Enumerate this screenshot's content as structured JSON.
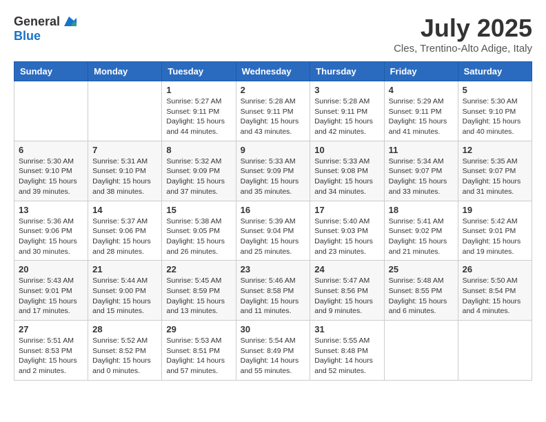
{
  "header": {
    "logo": {
      "general": "General",
      "blue": "Blue"
    },
    "title": "July 2025",
    "location": "Cles, Trentino-Alto Adige, Italy"
  },
  "calendar": {
    "weekdays": [
      "Sunday",
      "Monday",
      "Tuesday",
      "Wednesday",
      "Thursday",
      "Friday",
      "Saturday"
    ],
    "weeks": [
      [
        {
          "day": "",
          "info": ""
        },
        {
          "day": "",
          "info": ""
        },
        {
          "day": "1",
          "info": "Sunrise: 5:27 AM\nSunset: 9:11 PM\nDaylight: 15 hours and 44 minutes."
        },
        {
          "day": "2",
          "info": "Sunrise: 5:28 AM\nSunset: 9:11 PM\nDaylight: 15 hours and 43 minutes."
        },
        {
          "day": "3",
          "info": "Sunrise: 5:28 AM\nSunset: 9:11 PM\nDaylight: 15 hours and 42 minutes."
        },
        {
          "day": "4",
          "info": "Sunrise: 5:29 AM\nSunset: 9:11 PM\nDaylight: 15 hours and 41 minutes."
        },
        {
          "day": "5",
          "info": "Sunrise: 5:30 AM\nSunset: 9:10 PM\nDaylight: 15 hours and 40 minutes."
        }
      ],
      [
        {
          "day": "6",
          "info": "Sunrise: 5:30 AM\nSunset: 9:10 PM\nDaylight: 15 hours and 39 minutes."
        },
        {
          "day": "7",
          "info": "Sunrise: 5:31 AM\nSunset: 9:10 PM\nDaylight: 15 hours and 38 minutes."
        },
        {
          "day": "8",
          "info": "Sunrise: 5:32 AM\nSunset: 9:09 PM\nDaylight: 15 hours and 37 minutes."
        },
        {
          "day": "9",
          "info": "Sunrise: 5:33 AM\nSunset: 9:09 PM\nDaylight: 15 hours and 35 minutes."
        },
        {
          "day": "10",
          "info": "Sunrise: 5:33 AM\nSunset: 9:08 PM\nDaylight: 15 hours and 34 minutes."
        },
        {
          "day": "11",
          "info": "Sunrise: 5:34 AM\nSunset: 9:07 PM\nDaylight: 15 hours and 33 minutes."
        },
        {
          "day": "12",
          "info": "Sunrise: 5:35 AM\nSunset: 9:07 PM\nDaylight: 15 hours and 31 minutes."
        }
      ],
      [
        {
          "day": "13",
          "info": "Sunrise: 5:36 AM\nSunset: 9:06 PM\nDaylight: 15 hours and 30 minutes."
        },
        {
          "day": "14",
          "info": "Sunrise: 5:37 AM\nSunset: 9:06 PM\nDaylight: 15 hours and 28 minutes."
        },
        {
          "day": "15",
          "info": "Sunrise: 5:38 AM\nSunset: 9:05 PM\nDaylight: 15 hours and 26 minutes."
        },
        {
          "day": "16",
          "info": "Sunrise: 5:39 AM\nSunset: 9:04 PM\nDaylight: 15 hours and 25 minutes."
        },
        {
          "day": "17",
          "info": "Sunrise: 5:40 AM\nSunset: 9:03 PM\nDaylight: 15 hours and 23 minutes."
        },
        {
          "day": "18",
          "info": "Sunrise: 5:41 AM\nSunset: 9:02 PM\nDaylight: 15 hours and 21 minutes."
        },
        {
          "day": "19",
          "info": "Sunrise: 5:42 AM\nSunset: 9:01 PM\nDaylight: 15 hours and 19 minutes."
        }
      ],
      [
        {
          "day": "20",
          "info": "Sunrise: 5:43 AM\nSunset: 9:01 PM\nDaylight: 15 hours and 17 minutes."
        },
        {
          "day": "21",
          "info": "Sunrise: 5:44 AM\nSunset: 9:00 PM\nDaylight: 15 hours and 15 minutes."
        },
        {
          "day": "22",
          "info": "Sunrise: 5:45 AM\nSunset: 8:59 PM\nDaylight: 15 hours and 13 minutes."
        },
        {
          "day": "23",
          "info": "Sunrise: 5:46 AM\nSunset: 8:58 PM\nDaylight: 15 hours and 11 minutes."
        },
        {
          "day": "24",
          "info": "Sunrise: 5:47 AM\nSunset: 8:56 PM\nDaylight: 15 hours and 9 minutes."
        },
        {
          "day": "25",
          "info": "Sunrise: 5:48 AM\nSunset: 8:55 PM\nDaylight: 15 hours and 6 minutes."
        },
        {
          "day": "26",
          "info": "Sunrise: 5:50 AM\nSunset: 8:54 PM\nDaylight: 15 hours and 4 minutes."
        }
      ],
      [
        {
          "day": "27",
          "info": "Sunrise: 5:51 AM\nSunset: 8:53 PM\nDaylight: 15 hours and 2 minutes."
        },
        {
          "day": "28",
          "info": "Sunrise: 5:52 AM\nSunset: 8:52 PM\nDaylight: 15 hours and 0 minutes."
        },
        {
          "day": "29",
          "info": "Sunrise: 5:53 AM\nSunset: 8:51 PM\nDaylight: 14 hours and 57 minutes."
        },
        {
          "day": "30",
          "info": "Sunrise: 5:54 AM\nSunset: 8:49 PM\nDaylight: 14 hours and 55 minutes."
        },
        {
          "day": "31",
          "info": "Sunrise: 5:55 AM\nSunset: 8:48 PM\nDaylight: 14 hours and 52 minutes."
        },
        {
          "day": "",
          "info": ""
        },
        {
          "day": "",
          "info": ""
        }
      ]
    ]
  }
}
